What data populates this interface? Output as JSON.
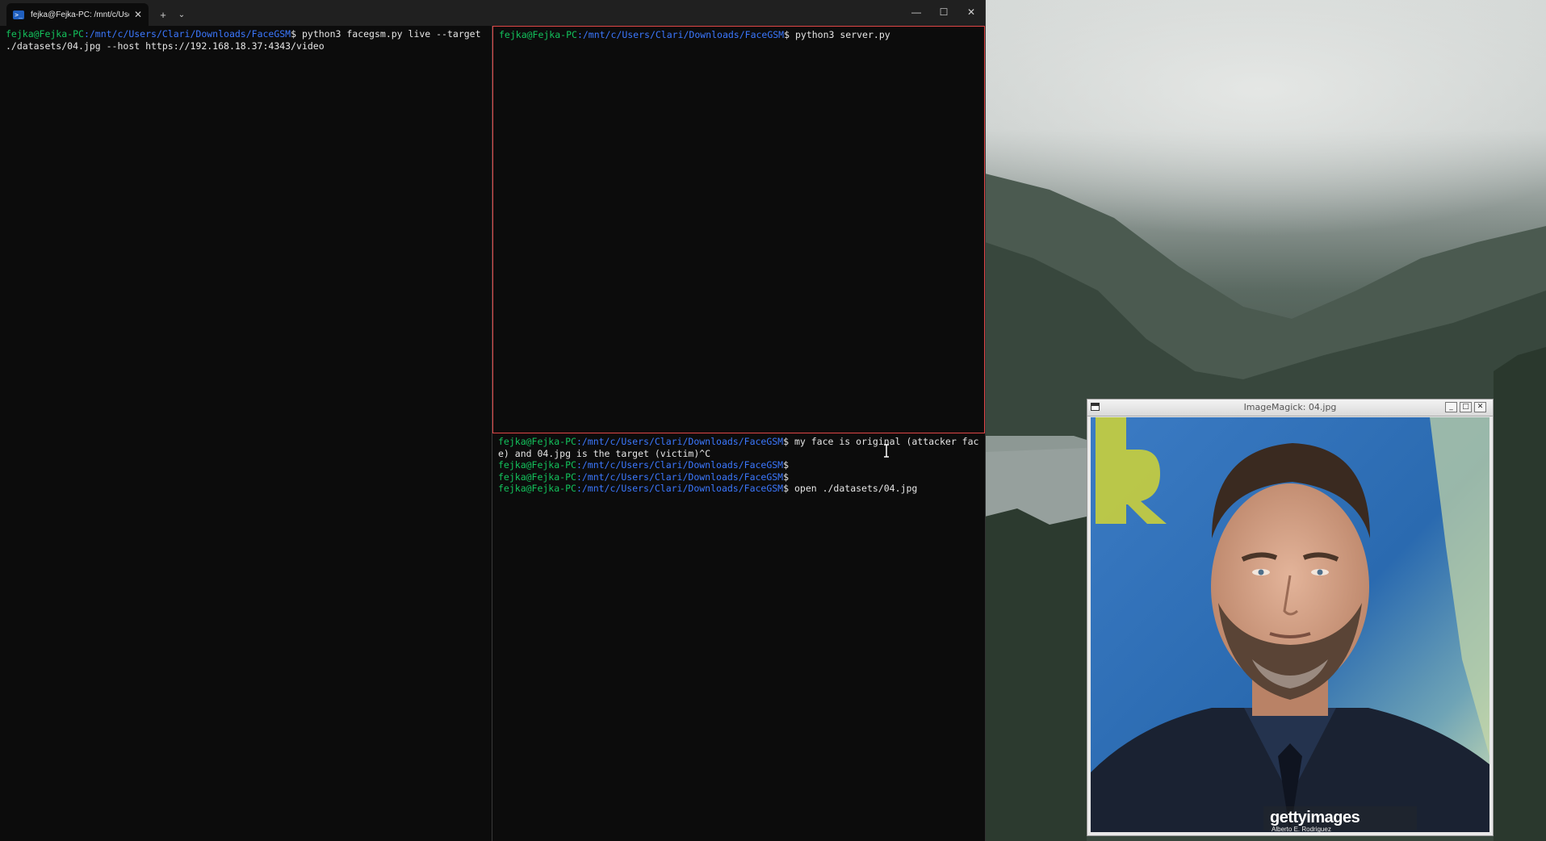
{
  "terminal": {
    "tab_title": "fejka@Fejka-PC: /mnt/c/Users",
    "tab_icon_glyph": ">_",
    "new_tab_glyph": "+",
    "dropdown_glyph": "⌄",
    "close_glyph": "✕",
    "window_controls": {
      "minimize": "—",
      "maximize": "☐",
      "close": "✕"
    },
    "panes": {
      "left": {
        "lines": [
          {
            "user": "fejka@Fejka-PC",
            "path": ":/mnt/c/Users/Clari/Downloads/FaceGSM",
            "cmd": "$ python3 facegsm.py live --target ./datasets/04.jpg --host https://192.168.18.37:4343/video"
          }
        ]
      },
      "top_right": {
        "lines": [
          {
            "user": "fejka@Fejka-PC",
            "path": ":/mnt/c/Users/Clari/Downloads/FaceGSM",
            "cmd": "$ python3 server.py"
          }
        ]
      },
      "bottom_right": {
        "lines": [
          {
            "user": "fejka@Fejka-PC",
            "path": ":/mnt/c/Users/Clari/Downloads/FaceGSM",
            "cmd": "$ my face is original (attacker face) and 04.jpg is the target (victim)^C"
          },
          {
            "user": "fejka@Fejka-PC",
            "path": ":/mnt/c/Users/Clari/Downloads/FaceGSM",
            "cmd": "$"
          },
          {
            "user": "fejka@Fejka-PC",
            "path": ":/mnt/c/Users/Clari/Downloads/FaceGSM",
            "cmd": "$"
          },
          {
            "user": "fejka@Fejka-PC",
            "path": ":/mnt/c/Users/Clari/Downloads/FaceGSM",
            "cmd": "$ open ./datasets/04.jpg"
          }
        ]
      }
    }
  },
  "imagemagick": {
    "title": "ImageMagick: 04.jpg",
    "buttons": {
      "minimize": "_",
      "maximize": "□",
      "close": "✕"
    },
    "watermark_brand": "gettyimages",
    "watermark_credit": "Alberto E. Rodriguez"
  },
  "colors": {
    "terminal_bg": "#0c0c0c",
    "prompt_user": "#13c25c",
    "prompt_path": "#3b78ff",
    "active_pane_border": "#e04646"
  }
}
